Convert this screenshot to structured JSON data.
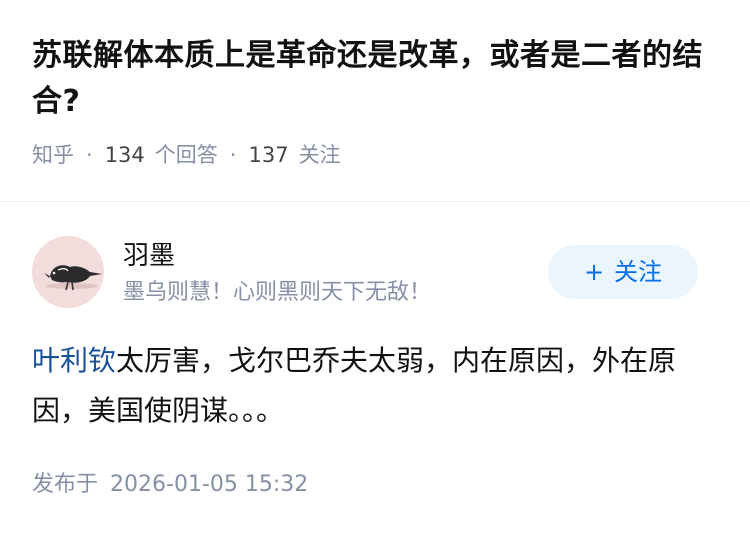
{
  "question": {
    "title": "苏联解体本质上是革命还是改革，或者是二者的结合?",
    "source": "知乎",
    "separator": "·",
    "answer_count": "134",
    "answer_label": "个回答",
    "follower_count": "137",
    "follower_label": "关注"
  },
  "author": {
    "name": "羽墨",
    "bio": "墨乌则慧！心则黑则天下无敌！",
    "avatar_icon": "crow-avatar-icon",
    "follow_plus": "+",
    "follow_label": "关注"
  },
  "answer": {
    "link_text": "叶利钦",
    "text": "太厉害，戈尔巴乔夫太弱，内在原因，外在原因，美国使阴谋。。。"
  },
  "publish": {
    "label": "发布于",
    "datetime": "2026-01-05 15:32"
  },
  "colors": {
    "title": "#121212",
    "meta": "#8590a6",
    "link": "#175199",
    "follow_text": "#056de8",
    "follow_bg": "#ebf5fd",
    "avatar_bg": "#f2dcdc"
  }
}
